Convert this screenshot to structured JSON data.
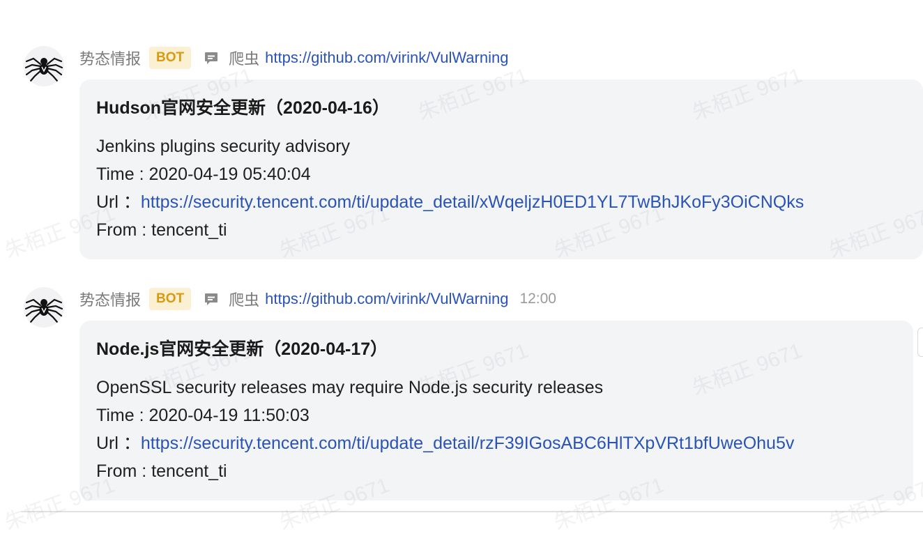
{
  "messages": [
    {
      "sender": "势态情报",
      "badge": "BOT",
      "channel": "爬虫",
      "source_url": "https://github.com/virink/VulWarning",
      "time": "",
      "title": "Hudson官网安全更新（2020-04-16）",
      "description": "Jenkins plugins security advisory",
      "time_line": "Time : 2020-04-19 05:40:04",
      "url_label": "Url ：",
      "url": "https://security.tencent.com/ti/update_detail/xWqeljzH0ED1YL7TwBhJKoFy3OiCNQks",
      "from_line": "From : tencent_ti"
    },
    {
      "sender": "势态情报",
      "badge": "BOT",
      "channel": "爬虫",
      "source_url": "https://github.com/virink/VulWarning",
      "time": "12:00",
      "title": "Node.js官网安全更新（2020-04-17）",
      "description": "OpenSSL security releases may require Node.js security releases",
      "time_line": "Time : 2020-04-19 11:50:03",
      "url_label": "Url ：",
      "url": "https://security.tencent.com/ti/update_detail/rzF39IGosABC6HlTXpVRt1bfUweOhu5v",
      "from_line": "From : tencent_ti"
    }
  ],
  "watermark_text": "朱栢正 9671",
  "icons": {
    "avatar": "spider-icon",
    "channel": "chat-bubble-icon"
  },
  "colors": {
    "link": "#2953b5",
    "badge_bg": "#fbf0d2",
    "badge_text": "#d99a12",
    "card_bg": "#f3f4f6"
  }
}
